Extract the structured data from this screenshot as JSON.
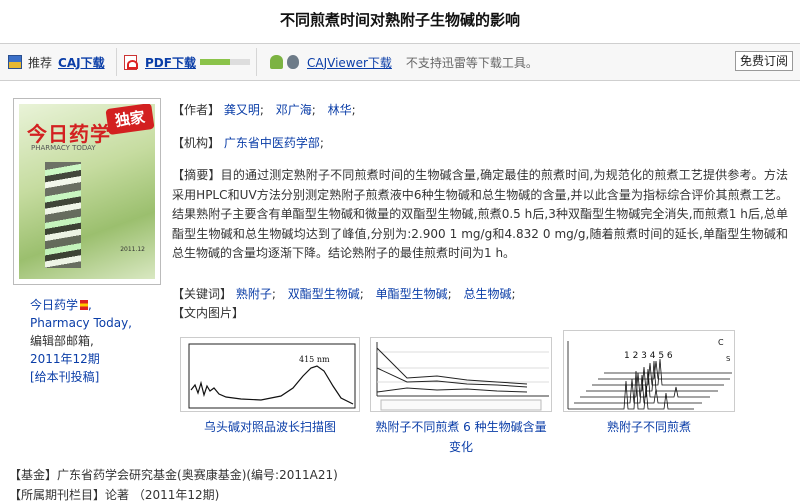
{
  "title": "不同煎煮时间对熟附子生物碱的影响",
  "toolbar": {
    "recommend": "推荐",
    "caj_download": "CAJ下载",
    "pdf_download": "PDF下载",
    "pdf_progress": 0.6,
    "cajviewer_download": "CAJViewer下载",
    "no_thunder_note": "不支持迅雷等下载工具。",
    "subscribe": "免费订阅"
  },
  "journal": {
    "cover_name": "今日药学",
    "cover_badge": "独家",
    "cover_subtitle": "PHARMACY TODAY",
    "cover_date": "2011.12",
    "name": "今日药学",
    "name_en": "Pharmacy Today,",
    "editor": "编辑部邮箱,",
    "issue": "2011年12期",
    "submit": "[给本刊投稿]"
  },
  "labels": {
    "authors": "【作者】",
    "institution": "【机构】",
    "abstract": "【摘要】",
    "keywords": "【关键词】",
    "figures": "【文内图片】",
    "fund": "【基金】",
    "column": "【所属期刊栏目】"
  },
  "authors": [
    "龚又明",
    "邓广海",
    "林华"
  ],
  "institution": "广东省中医药学部",
  "abstract": "目的通过测定熟附子不同煎煮时间的生物碱含量,确定最佳的煎煮时间,为规范化的煎煮工艺提供参考。方法 采用HPLC和UV方法分别测定熟附子煎煮液中6种生物碱和总生物碱的含量,并以此含量为指标综合评价其煎煮工艺。结果熟附子主要含有单酯型生物碱和微量的双酯型生物碱,煎煮0.5 h后,3种双酯型生物碱完全消失,而煎煮1 h后,总单酯型生物碱和总生物碱均达到了峰值,分别为:2.900 1 mg/g和4.832 0 mg/g,随着煎煮时间的延长,单酯型生物碱和总生物碱的含量均逐渐下降。结论熟附子的最佳煎煮时间为1 h。",
  "keywords": [
    "熟附子",
    "双酯型生物碱",
    "单酯型生物碱",
    "总生物碱"
  ],
  "figures": {
    "fig1_peak": "415 nm",
    "fig1_caption": "乌头碱对照品波长扫描图",
    "fig2_caption": "熟附子不同煎煮 6 种生物碱含量变化",
    "fig3_peaks": "1 2 3   4   5  6",
    "fig3_letters": [
      "C",
      "S"
    ],
    "fig3_caption": "熟附子不同煎煮"
  },
  "fund": "广东省药学会研究基金(奥赛康基金)(编号:2011A21)",
  "column": "论著 （2011年12期)",
  "colors": {
    "link": "#0b3ea8",
    "badge": "#d32020",
    "progress": "#8bc34a"
  }
}
